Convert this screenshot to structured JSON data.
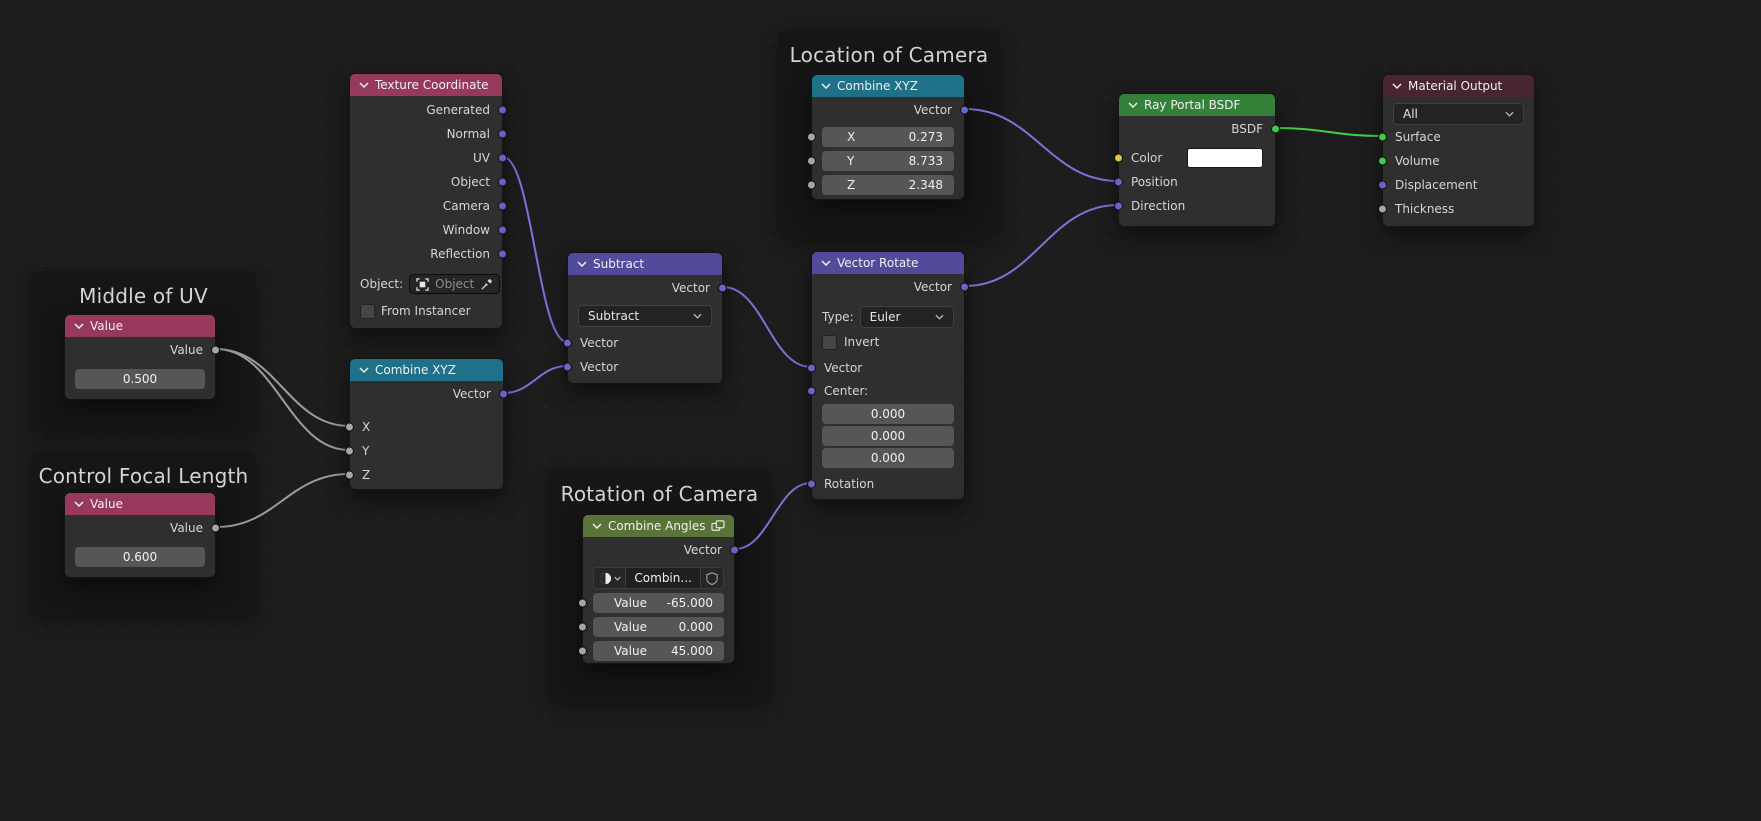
{
  "colors": {
    "canvas_bg": "#1d1d1d",
    "frame_bg": "#161616",
    "node_bg": "#2f2f2f",
    "header_input": "#96395c",
    "header_converter": "#1f7089",
    "header_vector": "#524b9c",
    "header_group": "#597339",
    "header_shader": "#338138",
    "header_output": "#482531",
    "socket_vector": "#6a63c8",
    "socket_value": "#a5a5a5",
    "socket_shader": "#3ec94a",
    "socket_color": "#e3c53d",
    "wire_vector": "#7a74d8",
    "wire_value": "#9c9c9c",
    "wire_shader": "#45cd45"
  },
  "frames": {
    "middle_of_uv": {
      "label": "Middle of UV"
    },
    "control_focal_length": {
      "label": "Control Focal Length"
    },
    "location_of_camera": {
      "label": "Location of Camera"
    },
    "rotation_of_camera": {
      "label": "Rotation of Camera"
    }
  },
  "nodes": {
    "value_uv": {
      "title": "Value",
      "output": "Value",
      "value": "0.500"
    },
    "value_focal": {
      "title": "Value",
      "output": "Value",
      "value": "0.600"
    },
    "texture_coordinate": {
      "title": "Texture Coordinate",
      "outputs": [
        "Generated",
        "Normal",
        "UV",
        "Object",
        "Camera",
        "Window",
        "Reflection"
      ],
      "object_label": "Object:",
      "object_field": "Object",
      "from_instancer": "From Instancer"
    },
    "combine_xyz_left": {
      "title": "Combine XYZ",
      "output": "Vector",
      "inputs": [
        "X",
        "Y",
        "Z"
      ]
    },
    "subtract": {
      "title": "Subtract",
      "output": "Vector",
      "operation": "Subtract",
      "inputs": [
        "Vector",
        "Vector"
      ]
    },
    "combine_xyz_location": {
      "title": "Combine XYZ",
      "output": "Vector",
      "rows": [
        {
          "label": "X",
          "value": "0.273"
        },
        {
          "label": "Y",
          "value": "8.733"
        },
        {
          "label": "Z",
          "value": "2.348"
        }
      ]
    },
    "vector_rotate": {
      "title": "Vector Rotate",
      "output": "Vector",
      "type_label": "Type:",
      "type": "Euler",
      "invert": "Invert",
      "vector_input": "Vector",
      "center_label": "Center:",
      "center": [
        "0.000",
        "0.000",
        "0.000"
      ],
      "rotation_input": "Rotation"
    },
    "combine_angles": {
      "title": "Combine Angles",
      "output": "Vector",
      "group_name": "Combin...",
      "rows": [
        {
          "label": "Value",
          "value": "-65.000"
        },
        {
          "label": "Value",
          "value": "0.000"
        },
        {
          "label": "Value",
          "value": "45.000"
        }
      ]
    },
    "ray_portal_bsdf": {
      "title": "Ray Portal BSDF",
      "output": "BSDF",
      "inputs": [
        "Color",
        "Position",
        "Direction"
      ]
    },
    "material_output": {
      "title": "Material Output",
      "target": "All",
      "inputs": [
        "Surface",
        "Volume",
        "Displacement",
        "Thickness"
      ]
    }
  }
}
